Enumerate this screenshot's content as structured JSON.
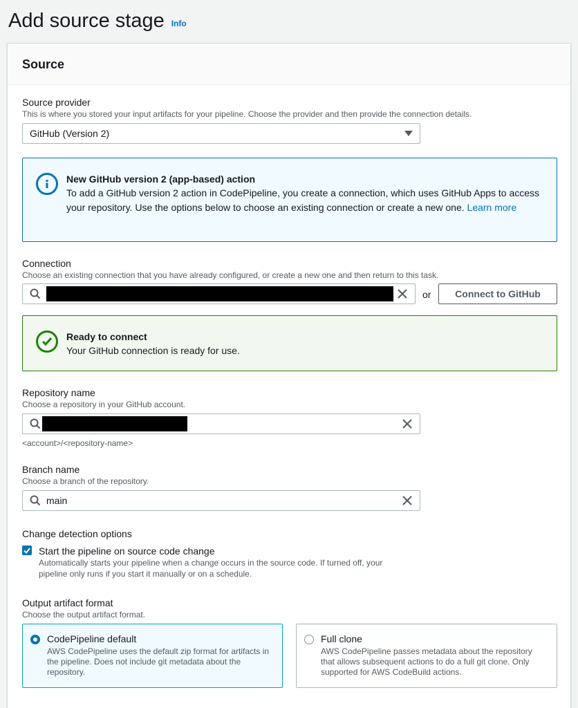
{
  "page": {
    "title": "Add source stage",
    "info_link": "Info"
  },
  "panel": {
    "title": "Source"
  },
  "source_provider": {
    "label": "Source provider",
    "description": "This is where you stored your input artifacts for your pipeline. Choose the provider and then provide the connection details.",
    "selected": "GitHub (Version 2)"
  },
  "info_alert": {
    "title": "New GitHub version 2 (app-based) action",
    "body": "To add a GitHub version 2 action in CodePipeline, you create a connection, which uses GitHub Apps to access your repository. Use the options below to choose an existing connection or create a new one.",
    "link": "Learn more"
  },
  "connection": {
    "label": "Connection",
    "description": "Choose an existing connection that you have already configured, or create a new one and then return to this task.",
    "or_text": "or",
    "button": "Connect to GitHub"
  },
  "success_alert": {
    "title": "Ready to connect",
    "body": "Your GitHub connection is ready for use."
  },
  "repository": {
    "label": "Repository name",
    "description": "Choose a repository in your GitHub account.",
    "hint": "<account>/<repository-name>"
  },
  "branch": {
    "label": "Branch name",
    "description": "Choose a branch of the repository.",
    "value": "main"
  },
  "change_detection": {
    "label": "Change detection options",
    "checkbox_label": "Start the pipeline on source code change",
    "checkbox_checked": true,
    "checkbox_description": "Automatically starts your pipeline when a change occurs in the source code. If turned off, your pipeline only runs if you start it manually or on a schedule."
  },
  "output_format": {
    "label": "Output artifact format",
    "description": "Choose the output artifact format.",
    "options": [
      {
        "title": "CodePipeline default",
        "description": "AWS CodePipeline uses the default zip format for artifacts in the pipeline. Does not include git metadata about the repository.",
        "selected": true
      },
      {
        "title": "Full clone",
        "description": "AWS CodePipeline passes metadata about the repository that allows subsequent actions to do a full git clone. Only supported for AWS CodeBuild actions.",
        "selected": false
      }
    ]
  },
  "colors": {
    "link": "#0073bb",
    "info_border": "#0073bb",
    "info_bg": "#f1faff",
    "success_border": "#1d8102",
    "success_bg": "#f2f8f0"
  },
  "icons": [
    "info-icon",
    "success-check-icon",
    "search-icon",
    "clear-icon",
    "caret-down-icon",
    "checkmark-icon"
  ]
}
